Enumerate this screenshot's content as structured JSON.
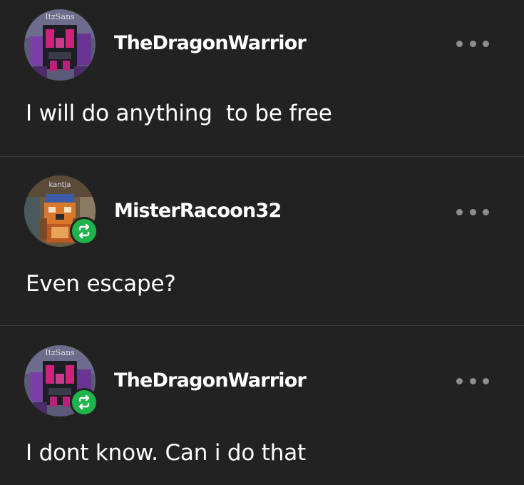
{
  "thread": {
    "posts": [
      {
        "avatar_caption": "ItzSans",
        "username": "TheDragonWarrior",
        "ghost_text": "",
        "reblogged": false,
        "message": "I will do anything  to be free"
      },
      {
        "avatar_caption": "kantja",
        "username": "MisterRacoon32",
        "reblogged": true,
        "message": "Even escape?"
      },
      {
        "avatar_caption": "ItzSans",
        "username": "TheDragonWarrior",
        "reblogged": true,
        "message": "I dont know. Can i do that"
      }
    ]
  },
  "icons": {
    "more": "more-options-icon",
    "reblog": "reblog-icon"
  },
  "colors": {
    "background": "#222222",
    "divider": "#3a3a3a",
    "text": "#ffffff",
    "dots": "#8e8e8e",
    "reblog_badge": "#1fb34b"
  }
}
